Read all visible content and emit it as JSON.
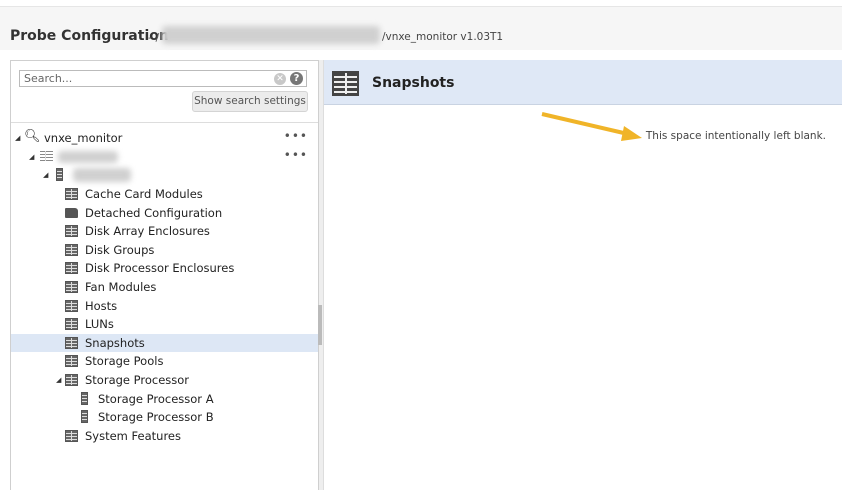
{
  "header": {
    "title": "Probe Configuration",
    "separator": "- /",
    "path_suffix": "/vnxe_monitor v1.03T1"
  },
  "search": {
    "placeholder": "Search...",
    "clear_icon": "clear-icon",
    "help_icon": "?",
    "settings_button": "Show search settings"
  },
  "tree": {
    "root": {
      "label": "vnxe_monitor",
      "menu": "•••"
    },
    "host_menu": "•••",
    "items": [
      {
        "label": "Cache Card Modules",
        "icon": "table-icon"
      },
      {
        "label": "Detached Configuration",
        "icon": "folder-icon"
      },
      {
        "label": "Disk Array Enclosures",
        "icon": "table-icon"
      },
      {
        "label": "Disk Groups",
        "icon": "table-icon"
      },
      {
        "label": "Disk Processor Enclosures",
        "icon": "table-icon"
      },
      {
        "label": "Fan Modules",
        "icon": "table-icon"
      },
      {
        "label": "Hosts",
        "icon": "table-icon"
      },
      {
        "label": "LUNs",
        "icon": "table-icon"
      },
      {
        "label": "Snapshots",
        "icon": "table-icon",
        "selected": true
      },
      {
        "label": "Storage Pools",
        "icon": "table-icon"
      },
      {
        "label": "Storage Processor",
        "icon": "table-icon",
        "expanded": true
      },
      {
        "label": "Storage Processor A",
        "icon": "server-icon",
        "child": true
      },
      {
        "label": "Storage Processor B",
        "icon": "server-icon",
        "child": true
      },
      {
        "label": "System Features",
        "icon": "table-icon"
      }
    ]
  },
  "main": {
    "title": "Snapshots",
    "message": "This space intentionally left blank."
  },
  "colors": {
    "header_bg": "#dfe8f6",
    "selected_bg": "#dde7f5",
    "arrow": "#f0b428"
  }
}
